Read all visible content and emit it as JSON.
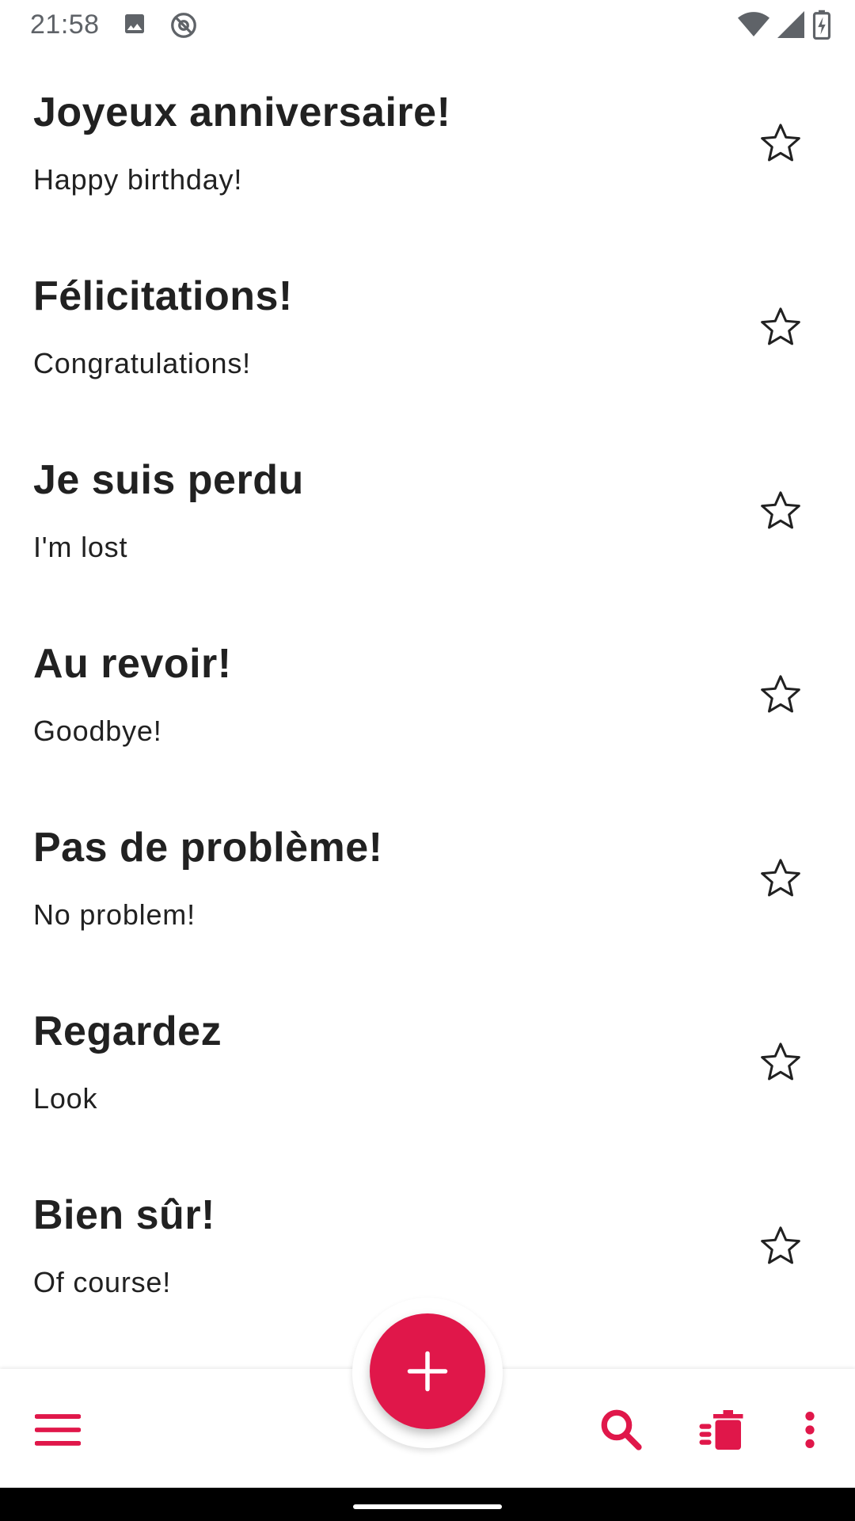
{
  "status_bar": {
    "time": "21:58",
    "left_icons": [
      "image-icon",
      "at-sign-icon"
    ],
    "right_icons": [
      "wifi-icon",
      "signal-icon",
      "battery-charging-icon"
    ]
  },
  "phrases": [
    {
      "phrase": "Joyeux anniversaire!",
      "translation": "Happy birthday!",
      "starred": false
    },
    {
      "phrase": "Félicitations!",
      "translation": "Congratulations!",
      "starred": false
    },
    {
      "phrase": "Je suis perdu",
      "translation": "I'm lost",
      "starred": false
    },
    {
      "phrase": "Au revoir!",
      "translation": "Goodbye!",
      "starred": false
    },
    {
      "phrase": "Pas de problème!",
      "translation": "No problem!",
      "starred": false
    },
    {
      "phrase": "Regardez",
      "translation": "Look",
      "starred": false
    },
    {
      "phrase": "Bien sûr!",
      "translation": "Of course!",
      "starred": false
    }
  ],
  "bottom_bar": {
    "menu_icon": "menu-icon",
    "fab_icon": "plus-icon",
    "search_icon": "search-icon",
    "delete_icon": "delete-sweep-icon",
    "more_icon": "more-vert-icon"
  },
  "colors": {
    "accent": "#e0174a",
    "text_primary": "#212121",
    "status_text": "#5f6368"
  }
}
